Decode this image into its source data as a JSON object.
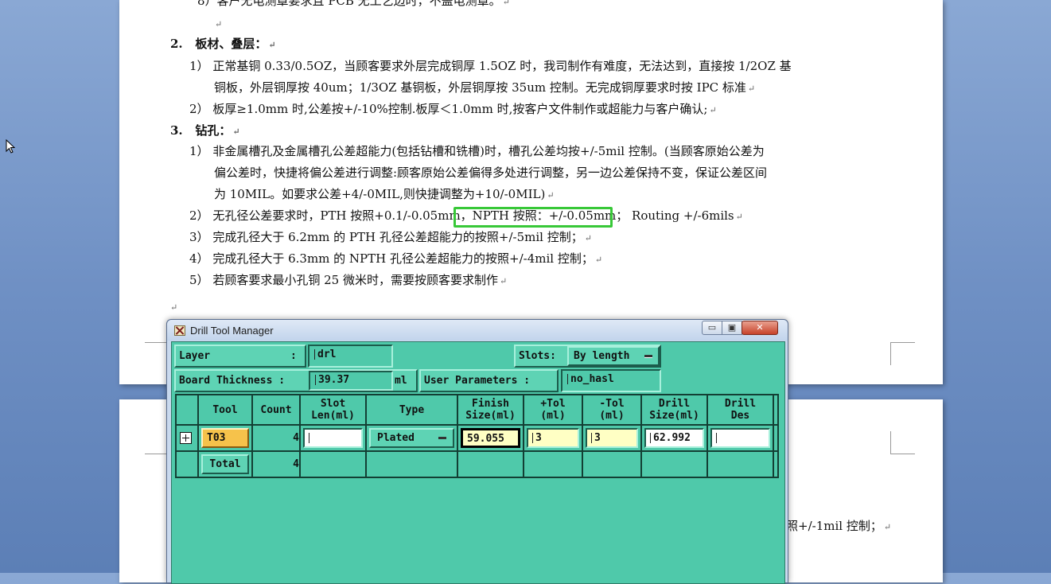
{
  "document": {
    "lines": {
      "l8": "8）客户无电测章要求且 PCB 无工艺边时，不盖电测章。",
      "h2_num": "2.",
      "h2_text": "板材、叠层：",
      "p2_1_num": "1）",
      "p2_1a": "正常基铜 0.33/0.5OZ，当顾客要求外层完成铜厚 1.5OZ 时，我司制作有难度，无法达到，直接按 1/2OZ 基",
      "p2_1b": "铜板，外层铜厚按 40um；1/3OZ 基铜板，外层铜厚按 35um 控制。无完成铜厚要求时按 IPC 标准",
      "p2_2_num": "2）",
      "p2_2": "板厚≥1.0mm 时,公差按+/-10%控制.板厚＜1.0mm 时,按客户文件制作或超能力与客户确认;",
      "h3_num": "3.",
      "h3_text": "钻孔：",
      "p3_1_num": "1）",
      "p3_1a": "非金属槽孔及金属槽孔公差超能力(包括钻槽和铣槽)时，槽孔公差均按+/-5mil 控制。(当顾客原始公差为",
      "p3_1b": "偏公差时，快捷将偏公差进行调整:顾客原始公差偏得多处进行调整，另一边公差保持不变，保证公差区间",
      "p3_1c": "为 10MIL。如要求公差+4/-0MIL,则快捷调整为+10/-0MIL)",
      "p3_2_num": "2）",
      "p3_2": "无孔径公差要求时，PTH 按照+0.1/-0.05mm，NPTH 按照：+/-0.05mm； Routing +/-6mils",
      "p3_3_num": "3）",
      "p3_3": "完成孔径大于 6.2mm 的 PTH 孔径公差超能力的按照+/-5mil 控制；",
      "p3_4_num": "4）",
      "p3_4": "完成孔径大于 6.3mm 的 NPTH 孔径公差超能力的按照+/-4mil 控制；",
      "p3_5_num": "5）",
      "p3_5": "若顾客要求最小孔铜 25 微米时，需要按顾客要求制作",
      "page2_fragment": "照+/-1mil 控制；"
    },
    "para_mark": "↵"
  },
  "window": {
    "title": "Drill Tool Manager",
    "min_glyph": "▭",
    "max_glyph": "▣",
    "close_glyph": "✕"
  },
  "form": {
    "layer_label": "Layer",
    "layer_colon": ":",
    "layer_value": "drl",
    "slots_label": "Slots:",
    "slots_value": "By length",
    "board_thickness_label": "Board Thickness :",
    "board_thickness_value": "39.37",
    "board_thickness_unit": "ml",
    "user_params_label": "User Parameters :",
    "user_params_value": "no_hasl"
  },
  "table": {
    "headers": [
      [
        "Tool"
      ],
      [
        "Count"
      ],
      [
        "Slot",
        "Len(ml)"
      ],
      [
        "Type"
      ],
      [
        "Finish",
        "Size(ml)"
      ],
      [
        "+Tol",
        "(ml)"
      ],
      [
        "-Tol",
        "(ml)"
      ],
      [
        "Drill",
        "Size(ml)"
      ],
      [
        "Drill",
        "Des"
      ]
    ],
    "row": {
      "tool": "T03",
      "count": "4",
      "slot_len": "",
      "type": "Plated",
      "finish_size": "59.055",
      "plus_tol": "3",
      "minus_tol": "3",
      "drill_size": "62.992",
      "drill_des": ""
    },
    "total": {
      "label": "Total",
      "count": "4"
    }
  }
}
